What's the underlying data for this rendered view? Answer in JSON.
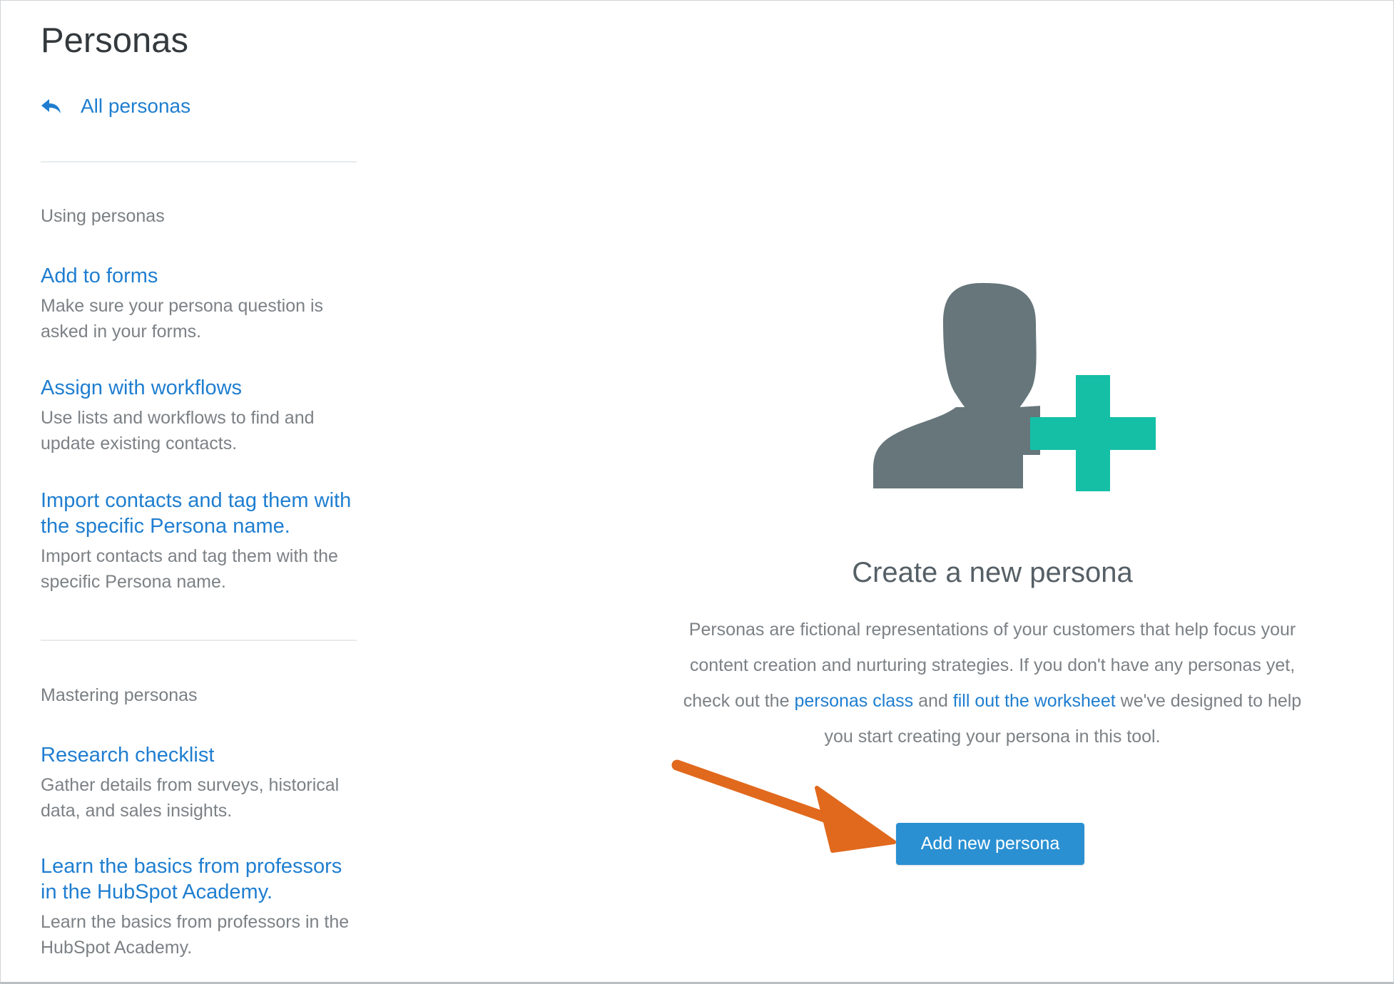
{
  "header": {
    "title": "Personas"
  },
  "sidebar": {
    "back_link_label": "All personas",
    "sections": [
      {
        "label": "Using personas",
        "items": [
          {
            "title": "Add to forms",
            "description": "Make sure your persona question is asked in your forms."
          },
          {
            "title": "Assign with workflows",
            "description": "Use lists and workflows to find and update existing contacts."
          },
          {
            "title": "Import contacts and tag them with the specific Persona name.",
            "description": "Import contacts and tag them with the specific Persona name."
          }
        ]
      },
      {
        "label": "Mastering personas",
        "items": [
          {
            "title": "Research checklist",
            "description": "Gather details from surveys, historical data, and sales insights."
          },
          {
            "title": "Learn the basics from professors in the HubSpot Academy.",
            "description": "Learn the basics from professors in the HubSpot Academy."
          }
        ]
      }
    ]
  },
  "empty_state": {
    "illustration_icon": "add-user-icon",
    "title": "Create a new persona",
    "body_part1": "Personas are fictional representations of your customers that help focus your content creation and nurturing strategies. If you don't have any personas yet, check out the ",
    "link1": "personas class",
    "body_part2": " and ",
    "link2": "fill out the worksheet",
    "body_part3": " we've designed to help you start creating your persona in this tool.",
    "button_label": "Add new persona"
  },
  "colors": {
    "link": "#1f7ed0",
    "button": "#2a90d2",
    "avatar_gray": "#66767b",
    "plus_teal": "#14bfa6",
    "annotation_arrow": "#e0691d"
  }
}
